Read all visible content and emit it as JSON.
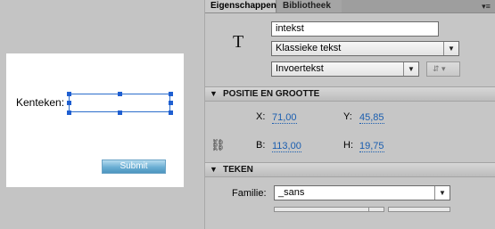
{
  "stage": {
    "label": "Kenteken:",
    "submit_label": "Submit"
  },
  "panel": {
    "tabs": [
      {
        "label": "Eigenschappen"
      },
      {
        "label": "Bibliotheek"
      }
    ],
    "menu_icon": "panel-menu-icon",
    "type_icon": "T",
    "instance_name": "intekst",
    "text_engine": "Klassieke tekst",
    "text_type": "Invoertekst",
    "sections": {
      "position_size": {
        "title": "POSITIE EN GROOTTE",
        "x_label": "X:",
        "x_value": "71,00",
        "y_label": "Y:",
        "y_value": "45,85",
        "w_label": "B:",
        "w_value": "113,00",
        "h_label": "H:",
        "h_value": "19,75"
      },
      "character": {
        "title": "TEKEN",
        "family_label": "Familie:",
        "family_value": "_sans"
      }
    }
  }
}
